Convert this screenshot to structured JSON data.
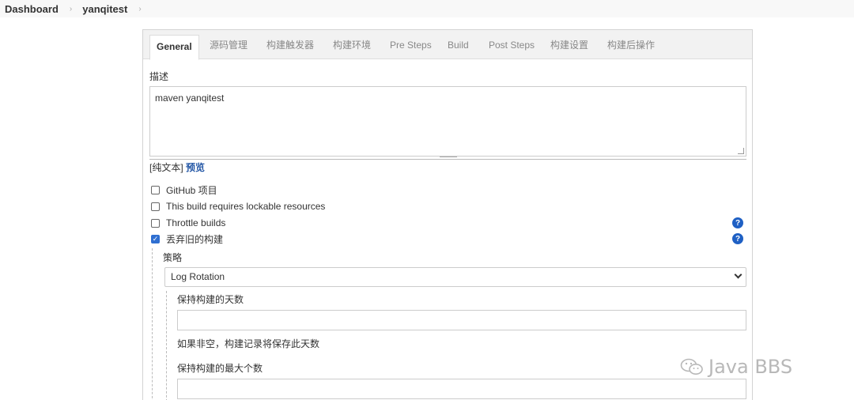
{
  "breadcrumb": {
    "items": [
      "Dashboard",
      "yanqitest"
    ],
    "separator": "›"
  },
  "tabs": [
    {
      "label": "General",
      "active": true
    },
    {
      "label": "源码管理",
      "active": false
    },
    {
      "label": "构建触发器",
      "active": false
    },
    {
      "label": "构建环境",
      "active": false
    },
    {
      "label": "Pre Steps",
      "active": false
    },
    {
      "label": "Build",
      "active": false
    },
    {
      "label": "Post Steps",
      "active": false
    },
    {
      "label": "构建设置",
      "active": false
    },
    {
      "label": "构建后操作",
      "active": false
    }
  ],
  "description": {
    "label": "描述",
    "value": "maven yanqitest",
    "plain_text_label": "[纯文本]",
    "preview_link": "预览"
  },
  "options": [
    {
      "label": "GitHub 项目",
      "checked": false,
      "help": false
    },
    {
      "label": "This build requires lockable resources",
      "checked": false,
      "help": false
    },
    {
      "label": "Throttle builds",
      "checked": false,
      "help": true
    },
    {
      "label": "丢弃旧的构建",
      "checked": true,
      "help": true
    }
  ],
  "strategy": {
    "label": "策略",
    "selected": "Log Rotation"
  },
  "days_to_keep": {
    "label": "保持构建的天数",
    "value": "",
    "hint": "如果非空，构建记录将保存此天数"
  },
  "max_builds": {
    "label": "保持构建的最大个数",
    "value": ""
  },
  "icons": {
    "help": "help-icon",
    "check": "check-icon",
    "chevron": "chevron-down-icon",
    "watermark": "wechat-icon"
  },
  "help_glyph": "?",
  "check_glyph": "✓",
  "colors": {
    "help": "#1f60c4",
    "checkbox_checked": "#2f6fd1",
    "link": "#2457a6"
  },
  "watermark": "Java BBS"
}
